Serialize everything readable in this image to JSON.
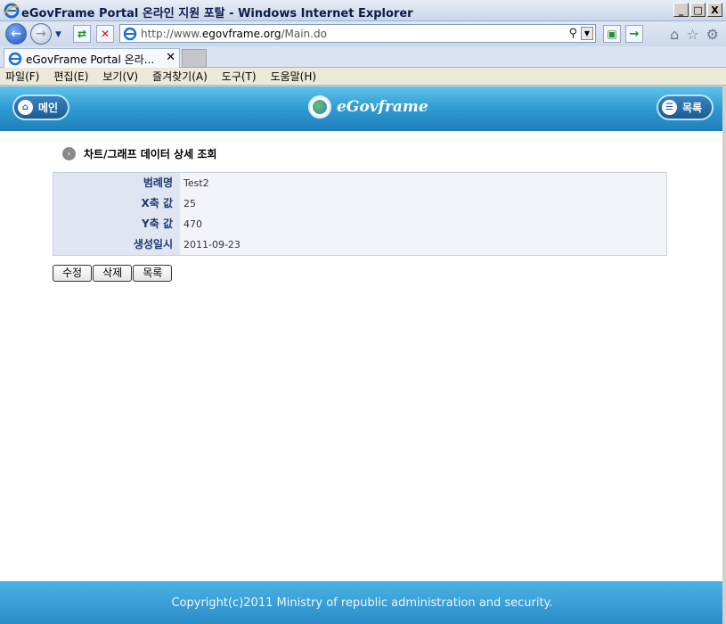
{
  "window": {
    "title": "eGovFrame Portal 온라인 지원 포탈 - Windows Internet Explorer",
    "minimize": "_",
    "maximize": "□",
    "close": "X"
  },
  "address_bar": {
    "url_prefix": "http://www.",
    "url_domain": "egovframe.org",
    "url_path": "/Main.do"
  },
  "tab": {
    "label": "eGovFrame Portal 온라...",
    "close": "✕"
  },
  "menu": [
    "파일(F)",
    "편집(E)",
    "보기(V)",
    "즐겨찾기(A)",
    "도구(T)",
    "도움말(H)"
  ],
  "header": {
    "main_label": "메인",
    "logo_text": "eGovframe",
    "list_label": "목록"
  },
  "section_title": "차트/그래프 데이터 상세 조회",
  "details": [
    {
      "label": "범례명",
      "value": "Test2"
    },
    {
      "label": "X축 값",
      "value": "25"
    },
    {
      "label": "Y축 값",
      "value": "470"
    },
    {
      "label": "생성일시",
      "value": "2011-09-23"
    }
  ],
  "actions": {
    "edit": "수정",
    "delete": "삭제",
    "list": "목록"
  },
  "footer": "Copyright(c)2011 Ministry of republic administration and security."
}
